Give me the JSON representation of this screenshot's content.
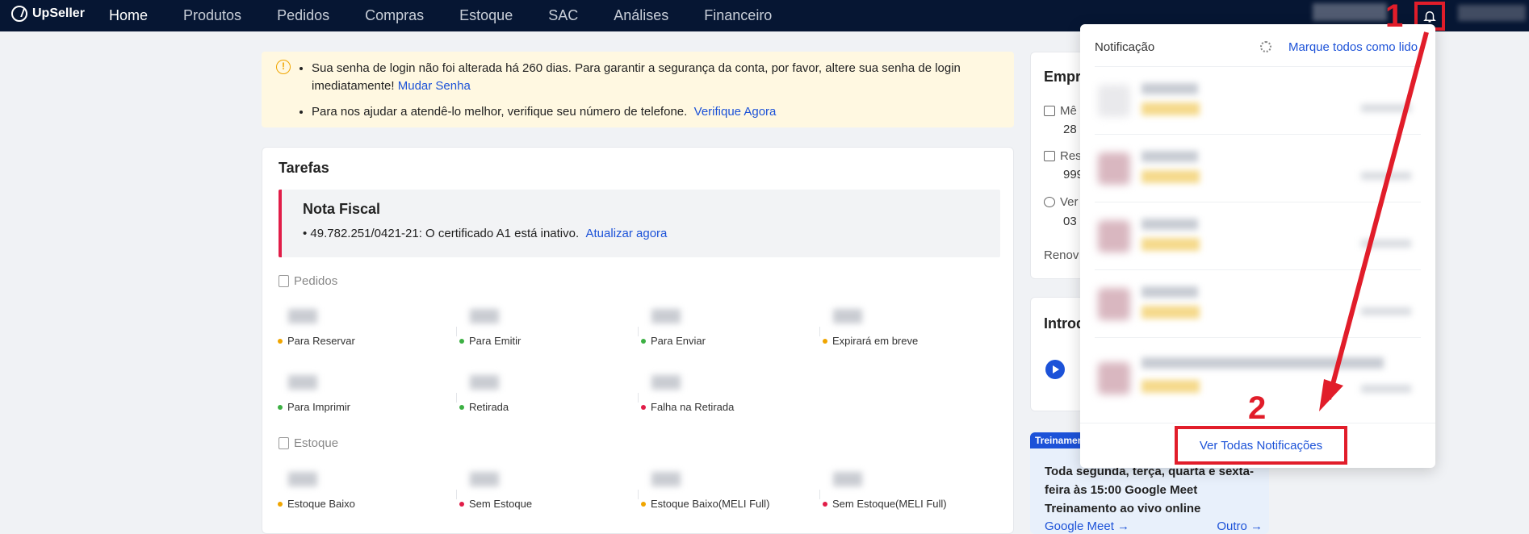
{
  "nav": {
    "logo": "UpSeller",
    "items": [
      {
        "label": "Home",
        "active": true
      },
      {
        "label": "Produtos",
        "active": false
      },
      {
        "label": "Pedidos",
        "active": false
      },
      {
        "label": "Compras",
        "active": false
      },
      {
        "label": "Estoque",
        "active": false
      },
      {
        "label": "SAC",
        "active": false
      },
      {
        "label": "Análises",
        "active": false
      },
      {
        "label": "Financeiro",
        "active": false
      }
    ],
    "bell_icon": "bell-icon"
  },
  "alert": {
    "line1": "Sua senha de login não foi alterada há 260 dias. Para garantir a segurança da conta, por favor, altere sua senha de login imediatamente!",
    "line1_link": "Mudar Senha",
    "line2": "Para nos ajudar a atendê-lo melhor, verifique seu número de telefone.",
    "line2_link": "Verifique Agora"
  },
  "tasks": {
    "title": "Tarefas",
    "fiscal": {
      "title": "Nota Fiscal",
      "text": "49.782.251/0421-21: O certificado A1 está inativo.",
      "link": "Atualizar agora"
    },
    "orders_section": "Pedidos",
    "orders": [
      {
        "label": "Para Reservar",
        "color": "#f0a500"
      },
      {
        "label": "Para Emitir",
        "color": "#3cb043"
      },
      {
        "label": "Para Enviar",
        "color": "#3cb043"
      },
      {
        "label": "Expirará em breve",
        "color": "#f0a500"
      },
      {
        "label": "Para Imprimir",
        "color": "#3cb043"
      },
      {
        "label": "Retirada",
        "color": "#3cb043"
      },
      {
        "label": "Falha na Retirada",
        "color": "#e11d48"
      }
    ],
    "stock_section": "Estoque",
    "stock": [
      {
        "label": "Estoque Baixo",
        "color": "#f0a500"
      },
      {
        "label": "Sem Estoque",
        "color": "#e11d48"
      },
      {
        "label": "Estoque Baixo(MELI Full)",
        "color": "#f0a500"
      },
      {
        "label": "Sem Estoque(MELI Full)",
        "color": "#e11d48"
      }
    ]
  },
  "right": {
    "company_title": "Empr",
    "row1": "Mê",
    "row1_sub": "28",
    "row2": "Res",
    "row2_sub": "999",
    "row3": "Ver",
    "row3_sub": "03",
    "renew": "Renov",
    "intro_title": "Introd",
    "training_tag": "Treinamen",
    "training_text": "Toda segunda, terça, quarta e sexta-feira às 15:00 Google Meet Treinamento ao vivo online",
    "google_meet": "Google Meet →",
    "other": "Outro →"
  },
  "notifications": {
    "title": "Notificação",
    "mark_all": "Marque todos como lido",
    "view_all": "Ver Todas Notificações"
  },
  "annotations": {
    "one": "1",
    "two": "2",
    "color": "#e11d2a"
  }
}
